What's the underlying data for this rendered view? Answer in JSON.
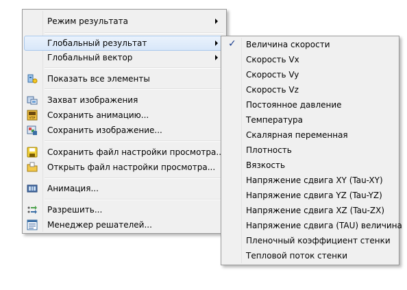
{
  "main_menu": {
    "items": [
      {
        "label": "Режим результата",
        "submenu": true
      },
      {
        "label": "Глобальный результат",
        "submenu": true
      },
      {
        "label": "Глобальный вектор",
        "submenu": true
      },
      {
        "label": "Показать все элементы",
        "icon": "show-all-icon"
      },
      {
        "label": "Захват изображения",
        "icon": "capture-icon"
      },
      {
        "label": "Сохранить анимацию...",
        "icon": "save-animation-icon"
      },
      {
        "label": "Сохранить изображение...",
        "icon": "save-image-icon"
      },
      {
        "label": "Сохранить файл настройки просмотра...",
        "icon": "save-view-settings-icon"
      },
      {
        "label": "Открыть файл настройки просмотра...",
        "icon": "open-view-settings-icon"
      },
      {
        "label": "Анимация...",
        "icon": "animation-icon"
      },
      {
        "label": "Разрешить...",
        "icon": "solve-icon"
      },
      {
        "label": "Менеджер решателей...",
        "icon": "solver-manager-icon"
      }
    ]
  },
  "sub_menu": {
    "items": [
      {
        "label": "Величина скорости",
        "checked": true
      },
      {
        "label": "Скорость Vx"
      },
      {
        "label": "Скорость Vy"
      },
      {
        "label": "Скорость Vz"
      },
      {
        "label": "Постоянное давление"
      },
      {
        "label": "Температура"
      },
      {
        "label": "Скалярная переменная"
      },
      {
        "label": "Плотность"
      },
      {
        "label": "Вязкость"
      },
      {
        "label": "Напряжение сдвига XY (Tau-XY)"
      },
      {
        "label": "Напряжение сдвига YZ (Tau-YZ)"
      },
      {
        "label": "Напряжение сдвига XZ (Tau-ZX)"
      },
      {
        "label": "Напряжение сдвига (TAU) величина"
      },
      {
        "label": "Пленочный коэффициент стенки"
      },
      {
        "label": "Тепловой поток стенки"
      }
    ]
  },
  "colors": {
    "menu_bg": "#f0f0f0",
    "highlight": "#d8e7f9",
    "highlight_border": "#a8c8ec",
    "check": "#1c3f8f"
  }
}
